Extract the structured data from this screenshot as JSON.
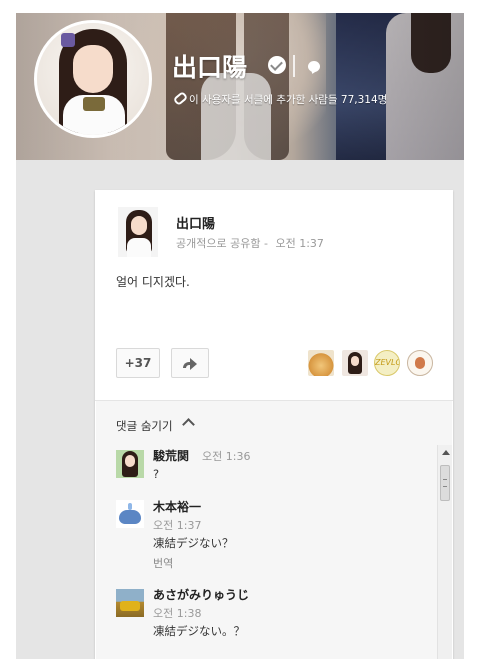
{
  "profile": {
    "name": "出口陽",
    "added_to_circles": "이 사용자를 서클에 추가한 사람들 77,314명"
  },
  "post": {
    "author": "出口陽",
    "visibility": "공개적으로 공유함",
    "separator": "-",
    "time": "오전 1:37",
    "text": "얼어 디지겠다.",
    "plus_count": "+37",
    "plusser_badge": "ZEVLC"
  },
  "comments_section": {
    "toggle_label": "댓글 숨기기",
    "comments": [
      {
        "author": "駿荒関",
        "time": "오전 1:36",
        "text": "?"
      },
      {
        "author": "木本裕一",
        "time": "오전 1:37",
        "text": "凍結デジない？",
        "translate": "번역"
      },
      {
        "author": "あさがみりゅうじ",
        "time": "오전 1:38",
        "text": "凍結デジない。？"
      }
    ]
  },
  "icons": {
    "verified": "verified-check-icon",
    "chat": "speech-bubble-icon",
    "link": "link-icon",
    "share": "share-arrow-icon",
    "chevron": "chevron-up-icon",
    "scroll_up": "scroll-up-arrow-icon"
  },
  "colors": {
    "background": "#e5e5e5",
    "card": "#ffffff",
    "meta_text": "#999999"
  }
}
